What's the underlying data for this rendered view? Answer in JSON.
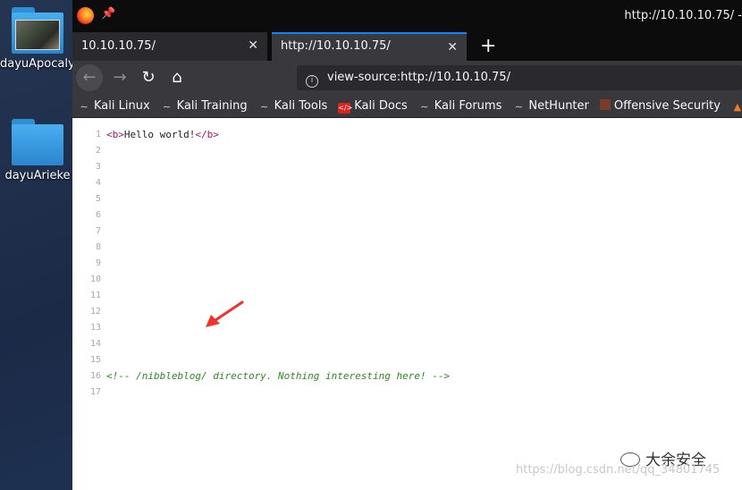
{
  "desktop": {
    "icons": [
      {
        "label": "dayuApocalys"
      },
      {
        "label": "dayuArieke"
      }
    ]
  },
  "browser": {
    "window_title": "http://10.10.10.75/ -",
    "tabs": [
      {
        "label": "10.10.10.75/",
        "active": false
      },
      {
        "label": "http://10.10.10.75/",
        "active": true
      }
    ],
    "new_tab_label": "+",
    "url": "view-source:http://10.10.10.75/",
    "bookmarks": [
      {
        "label": "Kali Linux",
        "icon": "kali-dragon-icon"
      },
      {
        "label": "Kali Training",
        "icon": "kali-dragon-icon"
      },
      {
        "label": "Kali Tools",
        "icon": "kali-dragon-icon"
      },
      {
        "label": "Kali Docs",
        "icon": "kali-docs-icon"
      },
      {
        "label": "Kali Forums",
        "icon": "kali-dragon-icon"
      },
      {
        "label": "NetHunter",
        "icon": "nethunter-icon"
      },
      {
        "label": "Offensive Security",
        "icon": "offsec-icon"
      }
    ],
    "accent": "#0a84ff"
  },
  "source": {
    "lines": [
      {
        "n": "1",
        "open_tag": "<b>",
        "text": "Hello world!",
        "close_tag": "</b>"
      },
      {
        "n": "2"
      },
      {
        "n": "3"
      },
      {
        "n": "4"
      },
      {
        "n": "5"
      },
      {
        "n": "6"
      },
      {
        "n": "7"
      },
      {
        "n": "8"
      },
      {
        "n": "9"
      },
      {
        "n": "10"
      },
      {
        "n": "11"
      },
      {
        "n": "12"
      },
      {
        "n": "13"
      },
      {
        "n": "14"
      },
      {
        "n": "15"
      },
      {
        "n": "16",
        "comment": "<!-- /nibbleblog/ directory. Nothing interesting here! -->"
      },
      {
        "n": "17"
      }
    ]
  },
  "overlay": {
    "wechat_label": "大余安全",
    "watermark": "https://blog.csdn.net/qq_34801745"
  }
}
